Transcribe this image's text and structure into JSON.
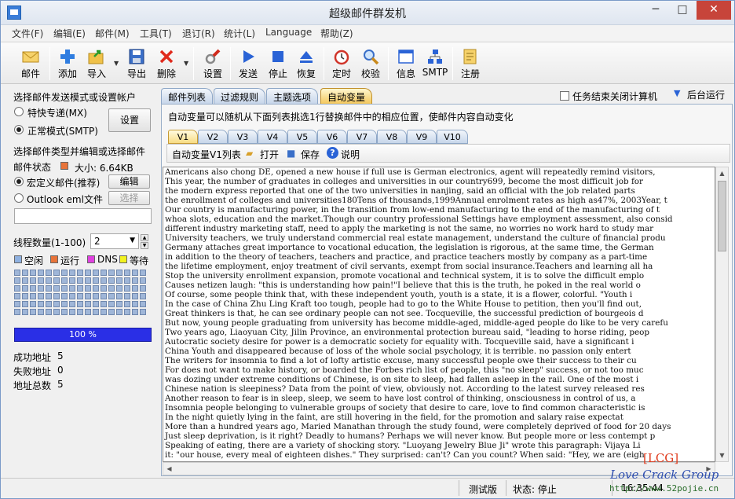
{
  "window": {
    "title": "超级邮件群发机",
    "controls": {
      "minimize": "─",
      "maximize": "□",
      "close": "✕"
    }
  },
  "menu": [
    "文件(F)",
    "编辑(E)",
    "邮件(M)",
    "工具(T)",
    "退订(R)",
    "统计(L)",
    "Language",
    "帮助(Z)"
  ],
  "toolbar": [
    {
      "label": "邮件",
      "icon": "mail-icon"
    },
    {
      "label": "添加",
      "icon": "add-icon"
    },
    {
      "label": "导入",
      "icon": "import-icon"
    },
    {
      "label": "导出",
      "icon": "save-icon"
    },
    {
      "label": "删除",
      "icon": "delete-icon"
    },
    {
      "label": "设置",
      "icon": "settings-icon"
    },
    {
      "label": "发送",
      "icon": "play-icon"
    },
    {
      "label": "停止",
      "icon": "stop-icon"
    },
    {
      "label": "恢复",
      "icon": "eject-icon"
    },
    {
      "label": "定时",
      "icon": "alarm-clock-icon"
    },
    {
      "label": "校验",
      "icon": "magnifier-icon"
    },
    {
      "label": "信息",
      "icon": "window-icon"
    },
    {
      "label": "SMTP",
      "icon": "network-icon"
    },
    {
      "label": "注册",
      "icon": "register-icon"
    }
  ],
  "left": {
    "send_mode_title": "选择邮件发送模式或设置帐户",
    "mode_mx": "特快专递(MX)",
    "mode_smtp": "正常模式(SMTP)",
    "settings_btn": "设置",
    "mail_type_title": "选择邮件类型并编辑或选择邮件",
    "mail_status_label": "邮件状态",
    "size_label": "大小: 6.64KB",
    "macro_mail": "宏定义邮件(推荐)",
    "edit_btn": "编辑",
    "outlook_eml": "Outlook eml文件",
    "select_btn": "选择",
    "threads_label": "线程数量(1-100)",
    "threads_value": "2",
    "legend": [
      {
        "label": "空闲",
        "color": "#8fb1e0"
      },
      {
        "label": "运行",
        "color": "#e8743a"
      },
      {
        "label": "DNS",
        "color": "#e040e0"
      },
      {
        "label": "等待",
        "color": "#f2f21e"
      }
    ],
    "progress": "100 %",
    "progress_fraction": 1.0,
    "stats": [
      {
        "label": "成功地址",
        "value": "5"
      },
      {
        "label": "失败地址",
        "value": "0"
      },
      {
        "label": "地址总数",
        "value": "5"
      }
    ]
  },
  "right": {
    "tabs": [
      "邮件列表",
      "过滤规则",
      "主题选项",
      "自动变量"
    ],
    "active_tab": 3,
    "shutdown_label": "任务结束关闭计算机",
    "background_run": "后台运行",
    "description": "自动变量可以随机从下面列表挑选1行替换邮件中的相应位置，使邮件内容自动变化",
    "var_tabs": [
      "V1",
      "V2",
      "V3",
      "V4",
      "V5",
      "V6",
      "V7",
      "V8",
      "V9",
      "V10"
    ],
    "subbar": {
      "list_label": "自动变量V1列表",
      "open": "打开",
      "save": "保存",
      "help": "说明"
    },
    "lines": [
      "Americans also chong DE, opened a new house if full use is German electronics, agent will repeatedly remind visitors,",
      "This year, the number of graduates in colleges and universities in our country699, become the most difficult job for",
      "the modern express reported that one of the two universities in nanjing, said an official with the job related parts",
      "the enrollment of colleges and universities180Tens of thousands,1999Annual enrolment rates as high as47%, 2003Year, t",
      "Our country is manufacturing power, in the transition from low-end manufacturing to the end of the manufacturing of t",
      "whoa slots, education and the market.Though our country professional Settings have employment assessment, also consid",
      "different industry marketing staff, need to apply the marketing is not the same, no worries no work hard to study mar",
      "University teachers, we truly understand commercial real estate management, understand the culture of financial produ",
      "Germany attaches great importance to vocational education, the legislation is rigorous, at the same time, the German",
      "in addition to the theory of teachers, teachers and practice, and practice teachers mostly by company as a part-time",
      "the lifetime employment, enjoy treatment of civil servants, exempt from social insurance.Teachers and learning all ha",
      "Stop the university enrollment expansion, promote vocational and technical system, it is to solve the difficult emplo",
      "Causes netizen laugh: \"this is understanding how pain!\"I believe that this is the truth, he poked in the real world o",
      "Of course, some people think that, with these independent youth, youth is a state, it is a flower, colorful. \"Youth i",
      "In the case of China Zhu Ling Kraft too tough, people had to go to the White House to petition, then you'll find out,",
      "Great thinkers is that, he can see ordinary people can not see. Tocqueville, the successful prediction of bourgeois d",
      "But now, young people graduating from university has become middle-aged, middle-aged people do like to be very carefu",
      "Two years ago, Liaoyuan City, Jilin Province, an environmental protection bureau said, \"leading to horse riding, peop",
      "Autocratic society desire for power is a democratic society for equality with. Tocqueville said, have a significant i",
      "China Youth and disappeared because of loss of the whole social psychology, it is terrible. no passion only entert",
      "The writers for insomnia to find a lot of lofty artistic excuse, many successful people owe their success to their cu",
      "For does not want to make history, or boarded the Forbes rich list of people, this \"no sleep\" success, or not too muc",
      "was dozing under extreme conditions of Chinese, is on site to sleep, had fallen asleep in the rail. One of the most i",
      "Chinese nation is sleepiness? Data from the point of view, obviously not. According to the latest survey released res",
      "Another reason to fear is in sleep, sleep, we seem to have lost control of thinking, onsciousness in control of us, a",
      "Insomnia people belonging to vulnerable groups of society that desire to care, love to find common characteristic is",
      "In the night quietly lying in the faint, are still hovering in the field, for the promotion and salary raise expectat",
      "More than a hundred years ago, Maried Manathan through the study found, were completely deprived of food for 20 days",
      "Just sleep deprivation, is it right? Deadly to humans? Perhaps we will never know. But people more or less contempt p",
      "Speaking of eating, there are a variety of shocking story. \"Luoyang Jewelry Blue Ji\" wrote this paragraph: Vijaya Li",
      "it: \"our house, every meal of eighteen dishes.\" They surprised: can't? Can you count? When said: \"Hey, we are (eigh"
    ]
  },
  "status": {
    "version": "测试版",
    "state": "状态: 停止",
    "time": "16:35:44"
  },
  "watermark": {
    "tag": "[LCG]",
    "group": "Love Crack Group",
    "url": "http://www.52pojie.cn"
  }
}
